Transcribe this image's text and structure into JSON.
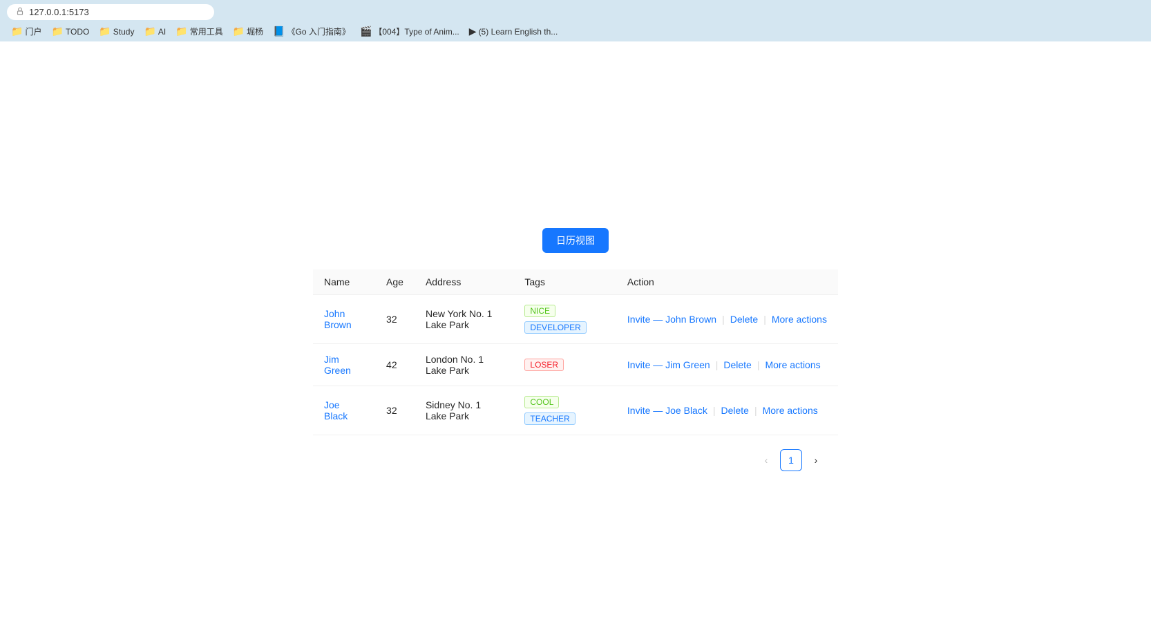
{
  "browser": {
    "url": "127.0.0.1:5173",
    "bookmarks": [
      {
        "label": "门户",
        "icon": "📁"
      },
      {
        "label": "TODO",
        "icon": "📁"
      },
      {
        "label": "Study",
        "icon": "📁"
      },
      {
        "label": "AI",
        "icon": "📁"
      },
      {
        "label": "常用工具",
        "icon": "📁"
      },
      {
        "label": "堀杨",
        "icon": "📁"
      },
      {
        "label": "《Go 入门指南》",
        "icon": "📘"
      },
      {
        "label": "【004】Type of Anim...",
        "icon": "🎬"
      },
      {
        "label": "(5) Learn English th...",
        "icon": "▶"
      }
    ]
  },
  "page": {
    "calendar_button_label": "日历视图",
    "table": {
      "columns": [
        "Name",
        "Age",
        "Address",
        "Tags",
        "Action"
      ],
      "rows": [
        {
          "name": "John Brown",
          "age": "32",
          "address": "New York No. 1 Lake Park",
          "tags": [
            {
              "label": "NICE",
              "type": "nice"
            },
            {
              "label": "DEVELOPER",
              "type": "developer"
            }
          ],
          "invite_label": "Invite — John Brown",
          "delete_label": "Delete",
          "more_actions_label": "More actions"
        },
        {
          "name": "Jim Green",
          "age": "42",
          "address": "London No. 1 Lake Park",
          "tags": [
            {
              "label": "LOSER",
              "type": "loser"
            }
          ],
          "invite_label": "Invite — Jim Green",
          "delete_label": "Delete",
          "more_actions_label": "More actions"
        },
        {
          "name": "Joe Black",
          "age": "32",
          "address": "Sidney No. 1 Lake Park",
          "tags": [
            {
              "label": "COOL",
              "type": "cool"
            },
            {
              "label": "TEACHER",
              "type": "teacher"
            }
          ],
          "invite_label": "Invite — Joe Black",
          "delete_label": "Delete",
          "more_actions_label": "More actions"
        }
      ]
    },
    "pagination": {
      "prev_label": "‹",
      "next_label": "›",
      "current_page": "1"
    }
  }
}
